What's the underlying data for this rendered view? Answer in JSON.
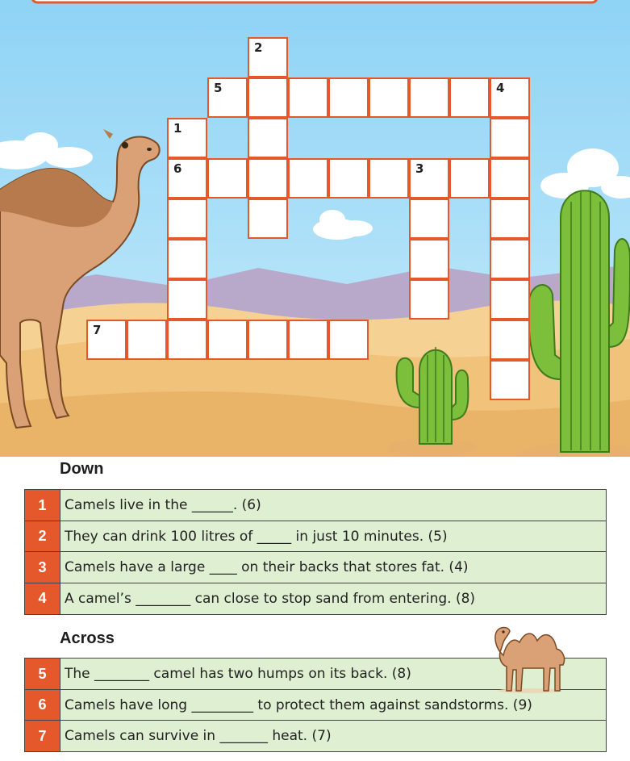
{
  "crossword": {
    "cells": [
      {
        "col": 4,
        "row": 0,
        "num": "2"
      },
      {
        "col": 3,
        "row": 1,
        "num": "5"
      },
      {
        "col": 4,
        "row": 1,
        "num": ""
      },
      {
        "col": 5,
        "row": 1,
        "num": ""
      },
      {
        "col": 6,
        "row": 1,
        "num": ""
      },
      {
        "col": 7,
        "row": 1,
        "num": ""
      },
      {
        "col": 8,
        "row": 1,
        "num": ""
      },
      {
        "col": 9,
        "row": 1,
        "num": ""
      },
      {
        "col": 10,
        "row": 1,
        "num": "4"
      },
      {
        "col": 2,
        "row": 2,
        "num": "1"
      },
      {
        "col": 4,
        "row": 2,
        "num": ""
      },
      {
        "col": 10,
        "row": 2,
        "num": ""
      },
      {
        "col": 2,
        "row": 3,
        "num": "6"
      },
      {
        "col": 3,
        "row": 3,
        "num": ""
      },
      {
        "col": 4,
        "row": 3,
        "num": ""
      },
      {
        "col": 5,
        "row": 3,
        "num": ""
      },
      {
        "col": 6,
        "row": 3,
        "num": ""
      },
      {
        "col": 7,
        "row": 3,
        "num": ""
      },
      {
        "col": 8,
        "row": 3,
        "num": "3"
      },
      {
        "col": 9,
        "row": 3,
        "num": ""
      },
      {
        "col": 10,
        "row": 3,
        "num": ""
      },
      {
        "col": 2,
        "row": 4,
        "num": ""
      },
      {
        "col": 4,
        "row": 4,
        "num": ""
      },
      {
        "col": 8,
        "row": 4,
        "num": ""
      },
      {
        "col": 10,
        "row": 4,
        "num": ""
      },
      {
        "col": 2,
        "row": 5,
        "num": ""
      },
      {
        "col": 8,
        "row": 5,
        "num": ""
      },
      {
        "col": 10,
        "row": 5,
        "num": ""
      },
      {
        "col": 2,
        "row": 6,
        "num": ""
      },
      {
        "col": 8,
        "row": 6,
        "num": ""
      },
      {
        "col": 10,
        "row": 6,
        "num": ""
      },
      {
        "col": 0,
        "row": 7,
        "num": "7"
      },
      {
        "col": 1,
        "row": 7,
        "num": ""
      },
      {
        "col": 2,
        "row": 7,
        "num": ""
      },
      {
        "col": 3,
        "row": 7,
        "num": ""
      },
      {
        "col": 4,
        "row": 7,
        "num": ""
      },
      {
        "col": 5,
        "row": 7,
        "num": ""
      },
      {
        "col": 6,
        "row": 7,
        "num": ""
      },
      {
        "col": 10,
        "row": 7,
        "num": ""
      },
      {
        "col": 10,
        "row": 8,
        "num": ""
      }
    ]
  },
  "down": {
    "heading": "Down",
    "clues": [
      {
        "num": "1",
        "text": "Camels live in the ______. (6)"
      },
      {
        "num": "2",
        "text": "They can drink 100 litres of _____ in just 10 minutes. (5)"
      },
      {
        "num": "3",
        "text": "Camels have a large ____ on their backs that stores fat. (4)"
      },
      {
        "num": "4",
        "text": "A camel’s ________ can close to stop sand from entering. (8)"
      }
    ]
  },
  "across": {
    "heading": "Across",
    "clues": [
      {
        "num": "5",
        "text": "The ________ camel has two humps on its back. (8)"
      },
      {
        "num": "6",
        "text": "Camels have long _________ to protect them against sandstorms. (9)"
      },
      {
        "num": "7",
        "text": "Camels can survive in _______ heat. (7)"
      }
    ]
  },
  "colors": {
    "accent": "#e4582b",
    "sky": "#9fd8f3",
    "sand": "#f2c47c",
    "clue_background": "#dff0d2",
    "cactus": "#7cbf3a"
  },
  "icons": [
    "camel-illustration",
    "cactus-illustration",
    "bactrian-camel-illustration"
  ]
}
